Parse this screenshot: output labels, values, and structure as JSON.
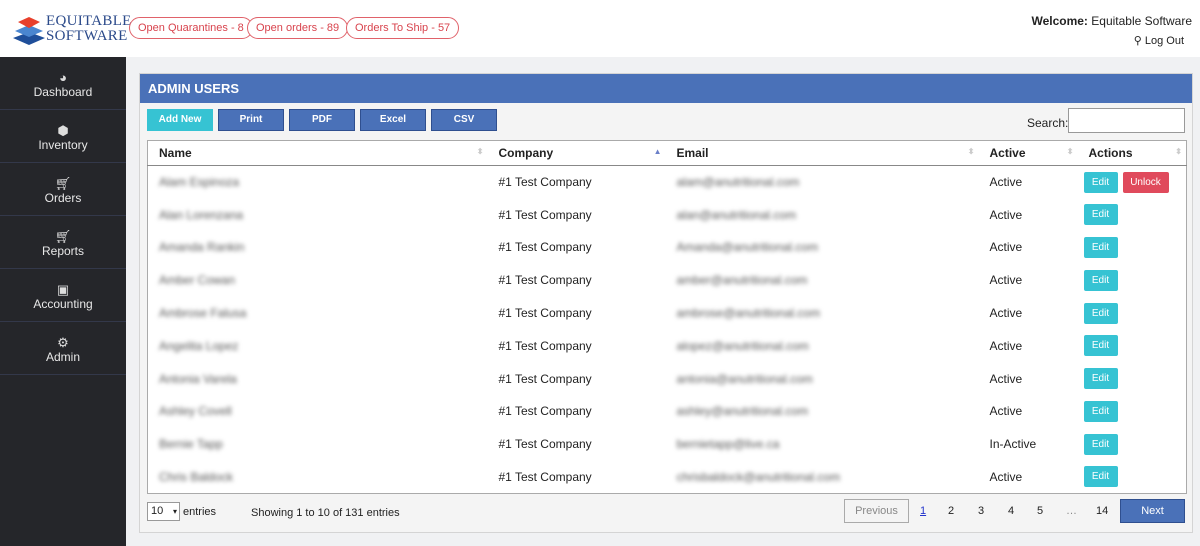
{
  "brand": {
    "line1": "EQUITABLE",
    "line2": "SOFTWARE"
  },
  "header": {
    "pills": [
      "Open Quarantines - 8",
      "Open orders - 89",
      "Orders To Ship - 57"
    ],
    "welcome_label": "Welcome:",
    "welcome_user": "Equitable Software",
    "logout": "Log Out",
    "logout_icon": "key-icon"
  },
  "sidebar": {
    "items": [
      {
        "label": "Dashboard",
        "icon": "tachometer-icon"
      },
      {
        "label": "Inventory",
        "icon": "cube-icon"
      },
      {
        "label": "Orders",
        "icon": "cart-icon"
      },
      {
        "label": "Reports",
        "icon": "cart-icon"
      },
      {
        "label": "Accounting",
        "icon": "money-bill-icon"
      },
      {
        "label": "Admin",
        "icon": "gear-icon"
      }
    ]
  },
  "panel": {
    "title": "ADMIN USERS",
    "buttons": {
      "add": "Add New",
      "print": "Print",
      "pdf": "PDF",
      "excel": "Excel",
      "csv": "CSV"
    },
    "search_label": "Search:",
    "search_value": ""
  },
  "table": {
    "columns": [
      "Name",
      "Company",
      "Email",
      "Active",
      "Actions"
    ],
    "sorted_column": "Company",
    "rows": [
      {
        "name": "Alam Espinoza",
        "company": "#1 Test Company",
        "email": "alam@anutritional.com",
        "active": "Active",
        "unlock": true
      },
      {
        "name": "Alan Lorenzana",
        "company": "#1 Test Company",
        "email": "alan@anutritional.com",
        "active": "Active"
      },
      {
        "name": "Amanda Rankin",
        "company": "#1 Test Company",
        "email": "Amanda@anutritional.com",
        "active": "Active"
      },
      {
        "name": "Amber Cowan",
        "company": "#1 Test Company",
        "email": "amber@anutritional.com",
        "active": "Active"
      },
      {
        "name": "Ambrose Falusa",
        "company": "#1 Test Company",
        "email": "ambrose@anutritional.com",
        "active": "Active"
      },
      {
        "name": "Angelita Lopez",
        "company": "#1 Test Company",
        "email": "alopez@anutritional.com",
        "active": "Active"
      },
      {
        "name": "Antonia Varela",
        "company": "#1 Test Company",
        "email": "antonia@anutritional.com",
        "active": "Active"
      },
      {
        "name": "Ashley Covell",
        "company": "#1 Test Company",
        "email": "ashley@anutritional.com",
        "active": "Active"
      },
      {
        "name": "Bernie Tapp",
        "company": "#1 Test Company",
        "email": "bernietapp@live.ca",
        "active": "In-Active"
      },
      {
        "name": "Chris Baldock",
        "company": "#1 Test Company",
        "email": "chrisbaldock@anutritional.com",
        "active": "Active"
      }
    ],
    "edit_label": "Edit",
    "unlock_label": "Unlock"
  },
  "footer": {
    "length_value": "10",
    "entries_label": "entries",
    "info": "Showing 1 to 10 of 131 entries",
    "previous": "Previous",
    "pages": [
      "1",
      "2",
      "3",
      "4",
      "5",
      "…",
      "14"
    ],
    "current_page": "1",
    "next": "Next"
  },
  "colors": {
    "accent": "#4a71b8",
    "info": "#36c3d3",
    "danger": "#e04a5c",
    "sidebar": "#25262a"
  }
}
